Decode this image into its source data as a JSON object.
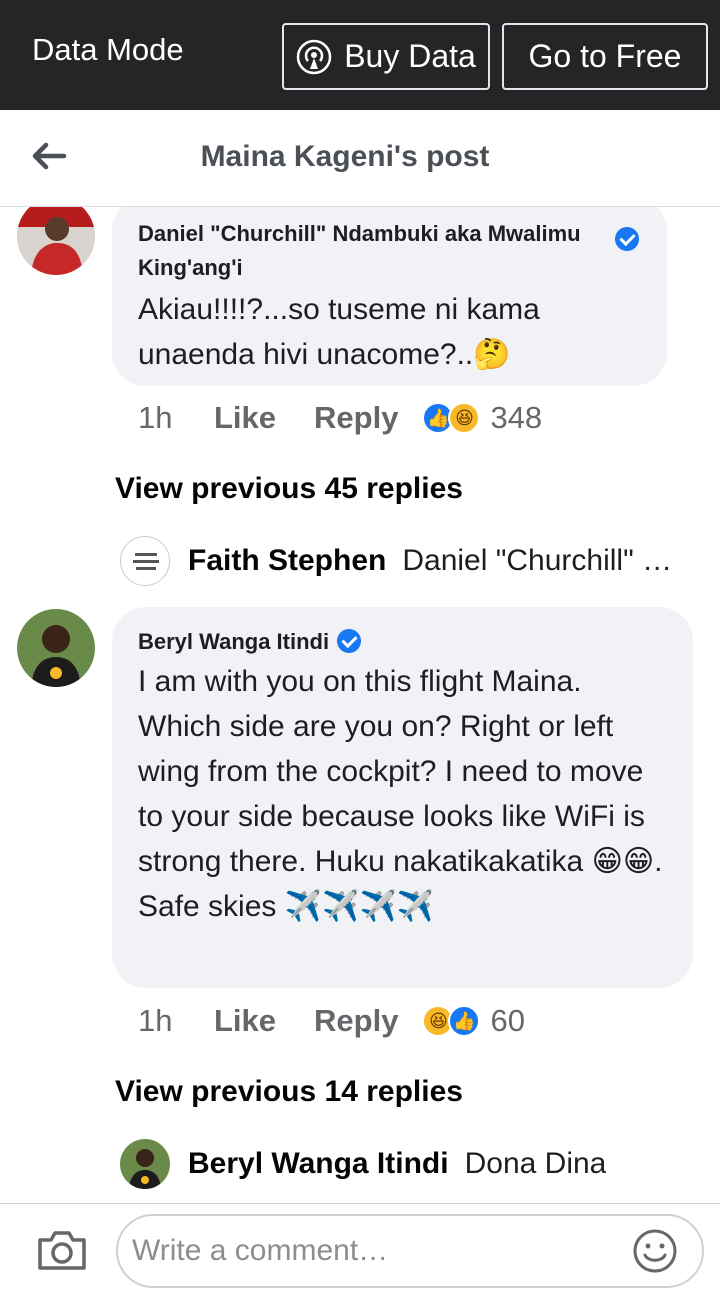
{
  "topbar": {
    "mode_label": "Data Mode",
    "buy_data": "Buy Data",
    "go_free": "Go to Free"
  },
  "header": {
    "title": "Maina Kageni's post"
  },
  "comments": [
    {
      "author": "Daniel \"Churchill\" Ndambuki aka Mwalimu King'ang'i",
      "verified": true,
      "text": "Akiau!!!!?...so tuseme ni kama unaenda hivi unacome?..🤔",
      "time": "1h",
      "like": "Like",
      "reply": "Reply",
      "reactions": [
        "like-icon",
        "haha-icon"
      ],
      "reaction_count": "348",
      "view_previous": "View previous 45 replies",
      "latest_reply": {
        "author": "Faith Stephen",
        "text": "Daniel \"Churchill\" Ndambuki aka Mwalimu King'ang'i"
      }
    },
    {
      "author": "Beryl Wanga Itindi",
      "verified": true,
      "text": "I am with you on this flight Maina. Which side are you on? Right or left wing from the cockpit? I need to move to your side because looks like WiFi is strong there. Huku nakatikakatika 😁😁. Safe skies ✈️✈️✈️✈️",
      "time": "1h",
      "like": "Like",
      "reply": "Reply",
      "reactions": [
        "haha-icon",
        "like-icon"
      ],
      "reaction_count": "60",
      "view_previous": "View previous 14 replies",
      "latest_reply": {
        "author": "Beryl Wanga Itindi",
        "text": "Dona Dina"
      }
    }
  ],
  "composer": {
    "placeholder": "Write a comment…"
  },
  "colors": {
    "topbar_bg": "#242526",
    "bubble_bg": "#f0f2f5",
    "accent": "#1877f2",
    "muted": "#65676b"
  }
}
